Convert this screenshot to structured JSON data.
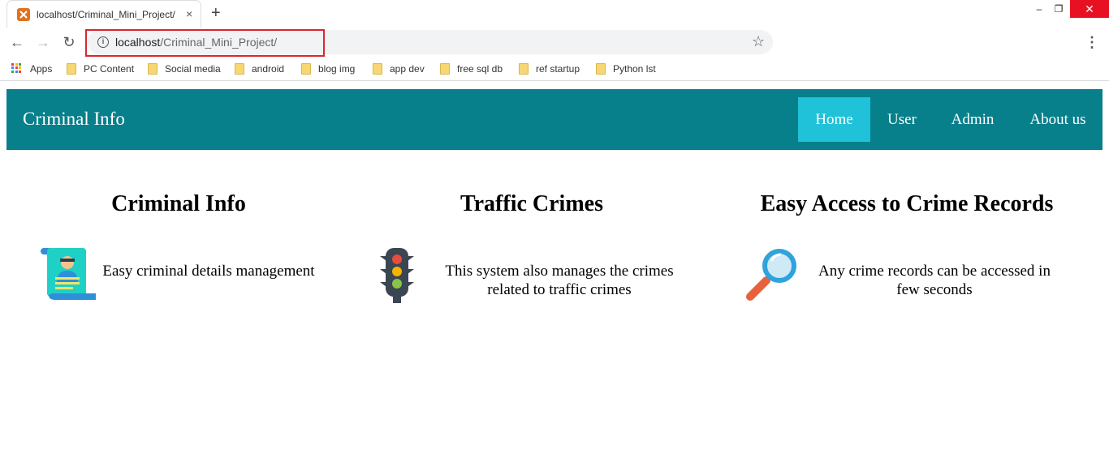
{
  "browser": {
    "tab_title": "localhost/Criminal_Mini_Project/",
    "tab_close": "×",
    "new_tab": "+",
    "url_host": "localhost",
    "url_path": "/Criminal_Mini_Project/",
    "window": {
      "minimize": "–",
      "maximize": "❐",
      "close": "✕"
    },
    "nav": {
      "back": "←",
      "forward": "→",
      "reload": "↻",
      "star": "☆",
      "menu": "⋮"
    },
    "bookmarks": [
      {
        "label": "Apps",
        "icon": "apps-grid-icon"
      },
      {
        "label": "PC Content",
        "icon": "folder-icon"
      },
      {
        "label": "Social media",
        "icon": "folder-icon"
      },
      {
        "label": "android",
        "icon": "folder-icon"
      },
      {
        "label": "blog img",
        "icon": "folder-icon"
      },
      {
        "label": "app dev",
        "icon": "folder-icon"
      },
      {
        "label": "free sql db",
        "icon": "folder-icon"
      },
      {
        "label": "ref startup",
        "icon": "folder-icon"
      },
      {
        "label": "Python lst",
        "icon": "folder-icon"
      }
    ]
  },
  "navbar": {
    "brand": "Criminal Info",
    "items": [
      {
        "label": "Home",
        "active": true
      },
      {
        "label": "User",
        "active": false
      },
      {
        "label": "Admin",
        "active": false
      },
      {
        "label": "About us",
        "active": false
      }
    ]
  },
  "features": [
    {
      "title": "Criminal Info",
      "text": "Easy criminal details management",
      "icon": "criminal-scroll-icon"
    },
    {
      "title": "Traffic Crimes",
      "text": "This system also manages the crimes related to traffic crimes",
      "icon": "traffic-light-icon"
    },
    {
      "title": "Easy Access to Crime Records",
      "text": "Any crime records can be accessed in few seconds",
      "icon": "magnifier-icon"
    }
  ],
  "colors": {
    "navbar": "#07808b",
    "active_nav": "#1fc2d8",
    "url_highlight": "#d9272e"
  }
}
